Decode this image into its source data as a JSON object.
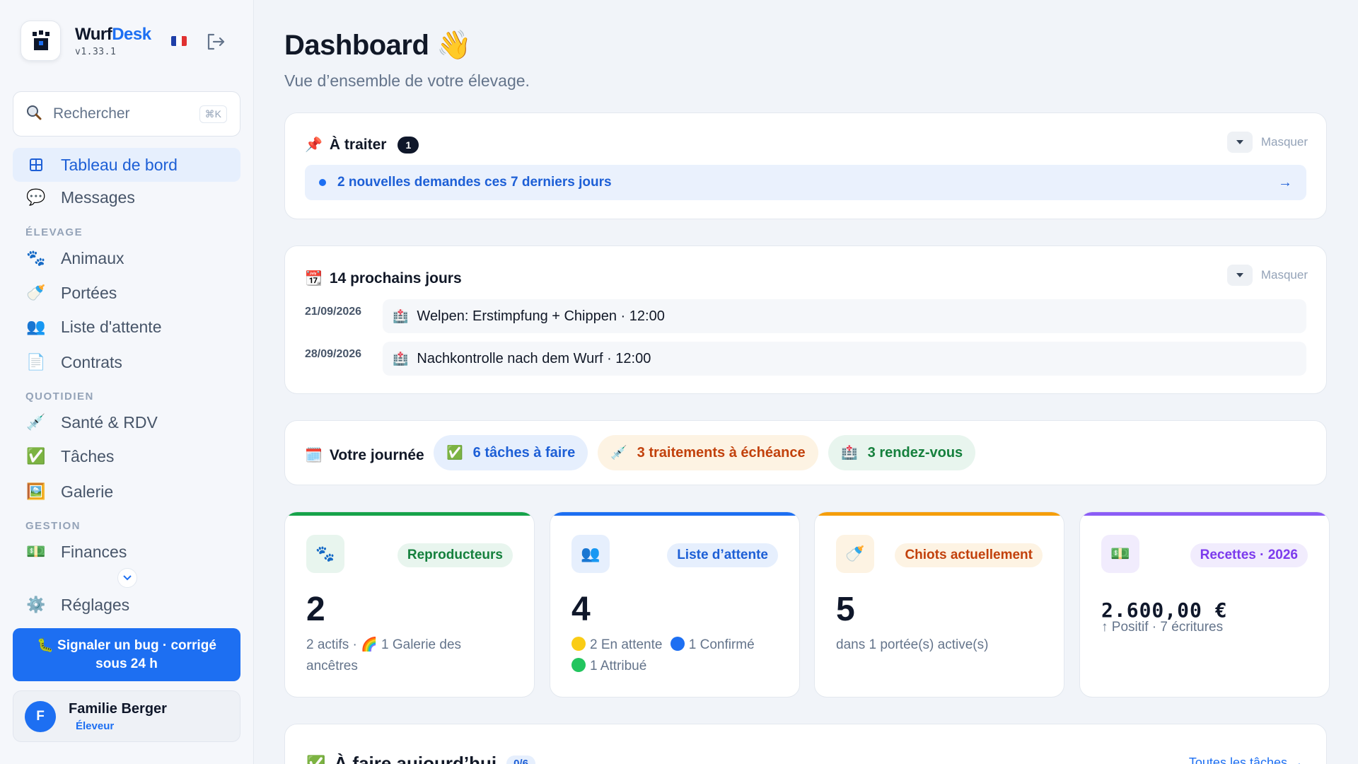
{
  "brand": {
    "name_prefix": "Wurf",
    "name_suffix": "Desk",
    "version": "v1.33.1"
  },
  "search": {
    "placeholder": "Rechercher",
    "shortcut": "⌘K"
  },
  "nav": {
    "dashboard": "Tableau de bord",
    "messages": "Messages",
    "section_breeding": "ÉLEVAGE",
    "animals": "Animaux",
    "litters": "Portées",
    "waitlist": "Liste d'attente",
    "contracts": "Contrats",
    "section_daily": "QUOTIDIEN",
    "health": "Santé & RDV",
    "tasks": "Tâches",
    "gallery": "Galerie",
    "section_management": "GESTION",
    "finances": "Finances",
    "settings": "Réglages"
  },
  "bug_button": "Signaler un bug · corrigé sous 24 h",
  "user": {
    "initial": "F",
    "name": "Familie Berger",
    "role": "Éleveur"
  },
  "page": {
    "title": "Dashboard 👋",
    "subtitle": "Vue d’ensemble de votre élevage."
  },
  "todo_panel": {
    "title": "À traiter",
    "count": "1",
    "hide_label": "Masquer",
    "item": "2 nouvelles demandes ces 7 derniers jours",
    "arrow": "→"
  },
  "upcoming": {
    "title": "14 prochains jours",
    "hide_label": "Masquer",
    "events": [
      {
        "date": "21/09/2026",
        "text": "Welpen: Erstimpfung + Chippen · 12:00"
      },
      {
        "date": "28/09/2026",
        "text": "Nachkontrolle nach dem Wurf · 12:00"
      }
    ]
  },
  "day": {
    "title": "Votre journée",
    "tasks": "6 tâches à faire",
    "treatments": "3 traitements à échéance",
    "appointments": "3 rendez-vous"
  },
  "stats": [
    {
      "badge": "Reproducteurs",
      "value": "2",
      "desc1": "2 actifs · 🌈 1 Galerie des ancêtres"
    },
    {
      "badge": "Liste d’attente",
      "value": "4",
      "desc_waiting": "2 En attente",
      "desc_confirmed": "1 Confirmé",
      "desc_assigned": "1 Attribué"
    },
    {
      "badge": "Chiots actuellement",
      "value": "5",
      "desc1": "dans 1 portée(s) active(s)"
    },
    {
      "badge": "Recettes · 2026",
      "value": "2.600,00 €",
      "desc1": "↑ Positif · 7 écritures"
    }
  ],
  "today": {
    "title": "À faire aujourd’hui",
    "count": "0/6",
    "link": "Toutes les tâches →"
  },
  "colors": {
    "accent": "#1d6ff2",
    "green": "#16a34a",
    "blue": "#1d6ff2",
    "orange": "#f59e0b",
    "purple": "#8b5cf6"
  }
}
